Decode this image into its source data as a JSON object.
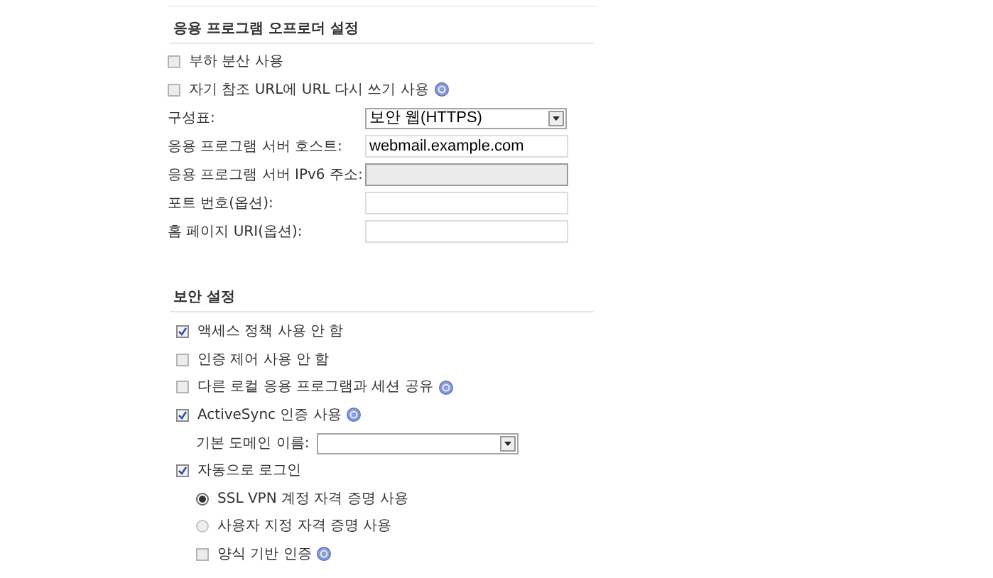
{
  "sections": [
    {
      "title": "응용 프로그램 오프로더 설정",
      "items": [
        {
          "kind": "checkbox",
          "label": "부하 분산 사용",
          "checked": false
        },
        {
          "kind": "checkbox",
          "label": "자기 참조 URL에 URL 다시 쓰기 사용",
          "checked": false,
          "help": true
        },
        {
          "kind": "select",
          "label": "구성표:",
          "value": "보안 웹(HTTPS)"
        },
        {
          "kind": "text",
          "label": "응용 프로그램 서버 호스트:",
          "value": "webmail.example.com"
        },
        {
          "kind": "text",
          "label": "응용 프로그램 서버 IPv6 주소:",
          "disabled": true
        },
        {
          "kind": "text",
          "label": "포트 번호(옵션):"
        },
        {
          "kind": "text",
          "label": "홈 페이지 URI(옵션):"
        }
      ]
    },
    {
      "title": "보안 설정",
      "items": [
        {
          "kind": "checkbox",
          "label": "액세스 정책 사용 안 함",
          "checked": true
        },
        {
          "kind": "checkbox",
          "label": "인증 제어 사용 안 함",
          "checked": false
        },
        {
          "kind": "checkbox",
          "label": "다른 로컬 응용 프로그램과 세션 공유",
          "checked": false,
          "help": true
        },
        {
          "kind": "checkbox",
          "label": "ActiveSync 인증 사용",
          "checked": true,
          "help": true,
          "children": [
            {
              "kind": "select",
              "label": "기본 도메인 이름:"
            }
          ]
        },
        {
          "kind": "checkbox",
          "label": "자동으로 로그인",
          "checked": true,
          "children": [
            {
              "kind": "radio",
              "label": "SSL VPN 계정 자격 증명 사용",
              "selected": true
            },
            {
              "kind": "radio",
              "label": "사용자 지정 자격 증명 사용",
              "selected": false
            },
            {
              "kind": "checkbox",
              "label": "양식 기반 인증",
              "checked": false,
              "help": true
            }
          ]
        }
      ]
    }
  ]
}
